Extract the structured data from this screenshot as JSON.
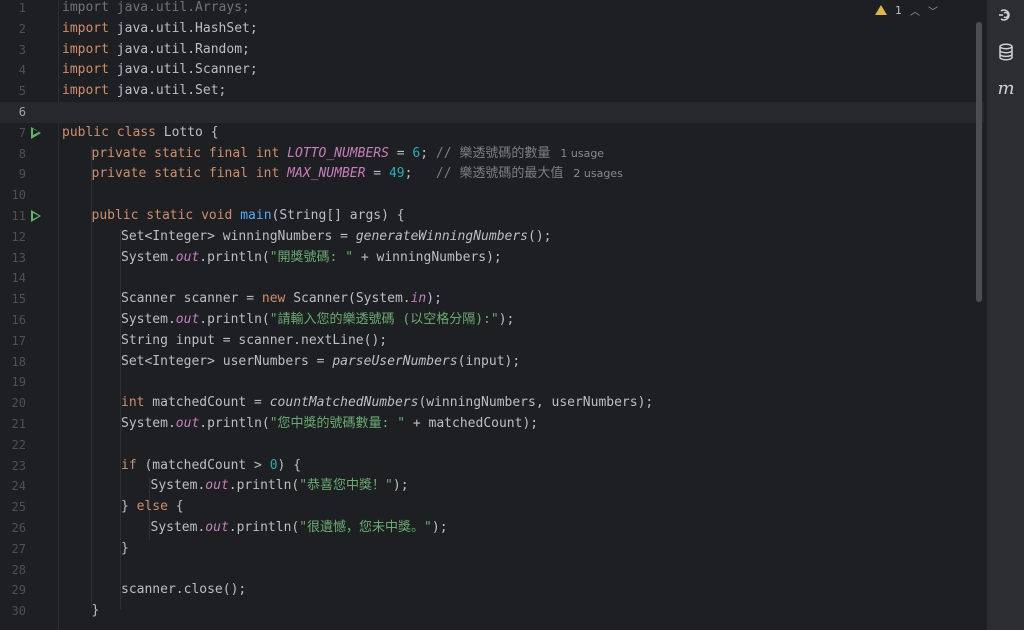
{
  "editor": {
    "line_numbers": [
      "1",
      "2",
      "3",
      "4",
      "5",
      "6",
      "7",
      "8",
      "9",
      "10",
      "11",
      "12",
      "13",
      "14",
      "15",
      "16",
      "17",
      "18",
      "19",
      "20",
      "21",
      "22",
      "23",
      "24",
      "25",
      "26",
      "27",
      "28",
      "29",
      "30"
    ],
    "warnings_count": "1",
    "code": {
      "l1": "import java.util.Arrays;",
      "l2_kw": "import",
      "l2_rest": " java.util.HashSet;",
      "l3_kw": "import",
      "l3_rest": " java.util.Random;",
      "l4_kw": "import",
      "l4_rest": " java.util.Scanner;",
      "l5_kw": "import",
      "l5_rest": " java.util.Set;",
      "l7_kw": "public class",
      "l7_rest": " Lotto {",
      "l8_kw": "private static final int",
      "l8_const": "LOTTO_NUMBERS",
      "l8_eq": " = ",
      "l8_num": "6",
      "l8_semi": "; ",
      "l8_comment": "// 樂透號碼的數量",
      "l8_hint": "1 usage",
      "l9_kw": "private static final int",
      "l9_const": "MAX_NUMBER",
      "l9_eq": " = ",
      "l9_num": "49",
      "l9_semi": ";   ",
      "l9_comment": "// 樂透號碼的最大值",
      "l9_hint": "2 usages",
      "l11_kw": "public static void",
      "l11_fn": "main",
      "l11_rest": "(String[] args) {",
      "l12_a": "Set<Integer> winningNumbers = ",
      "l12_call": "generateWinningNumbers",
      "l12_b": "();",
      "l13_a": "System.",
      "l13_field": "out",
      "l13_b": ".println(",
      "l13_str": "\"開獎號碼: \"",
      "l13_c": " + winningNumbers);",
      "l15_a": "Scanner scanner = ",
      "l15_kw": "new",
      "l15_b": " Scanner(System.",
      "l15_field": "in",
      "l15_c": ");",
      "l16_a": "System.",
      "l16_field": "out",
      "l16_b": ".println(",
      "l16_str": "\"請輸入您的樂透號碼 (以空格分隔):\"",
      "l16_c": ");",
      "l17": "String input = scanner.nextLine();",
      "l18_a": "Set<Integer> userNumbers = ",
      "l18_call": "parseUserNumbers",
      "l18_b": "(input);",
      "l20_kw": "int",
      "l20_a": " matchedCount = ",
      "l20_call": "countMatchedNumbers",
      "l20_b": "(winningNumbers, userNumbers);",
      "l21_a": "System.",
      "l21_field": "out",
      "l21_b": ".println(",
      "l21_str": "\"您中獎的號碼數量: \"",
      "l21_c": " + matchedCount);",
      "l23_kw": "if",
      "l23_a": " (matchedCount > ",
      "l23_num": "0",
      "l23_b": ") {",
      "l24_a": "System.",
      "l24_field": "out",
      "l24_b": ".println(",
      "l24_str": "\"恭喜您中獎！\"",
      "l24_c": ");",
      "l25_a": "} ",
      "l25_kw": "else",
      "l25_b": " {",
      "l26_a": "System.",
      "l26_field": "out",
      "l26_b": ".println(",
      "l26_str": "\"很遺憾，您未中獎。\"",
      "l26_c": ");",
      "l27": "}",
      "l29": "scanner.close();",
      "l30": "}"
    }
  },
  "sidebar": {
    "icons": [
      "ai-assistant-icon",
      "database-icon",
      "maven-icon"
    ],
    "maven_glyph": "m"
  },
  "colors": {
    "background": "#1e1f22",
    "keyword": "#cf8e6d",
    "string": "#6aab73",
    "number": "#2aacb8",
    "constant": "#c77dbb",
    "function": "#56a8f5",
    "run_icon": "#5fb865",
    "warning": "#e0b34b"
  }
}
